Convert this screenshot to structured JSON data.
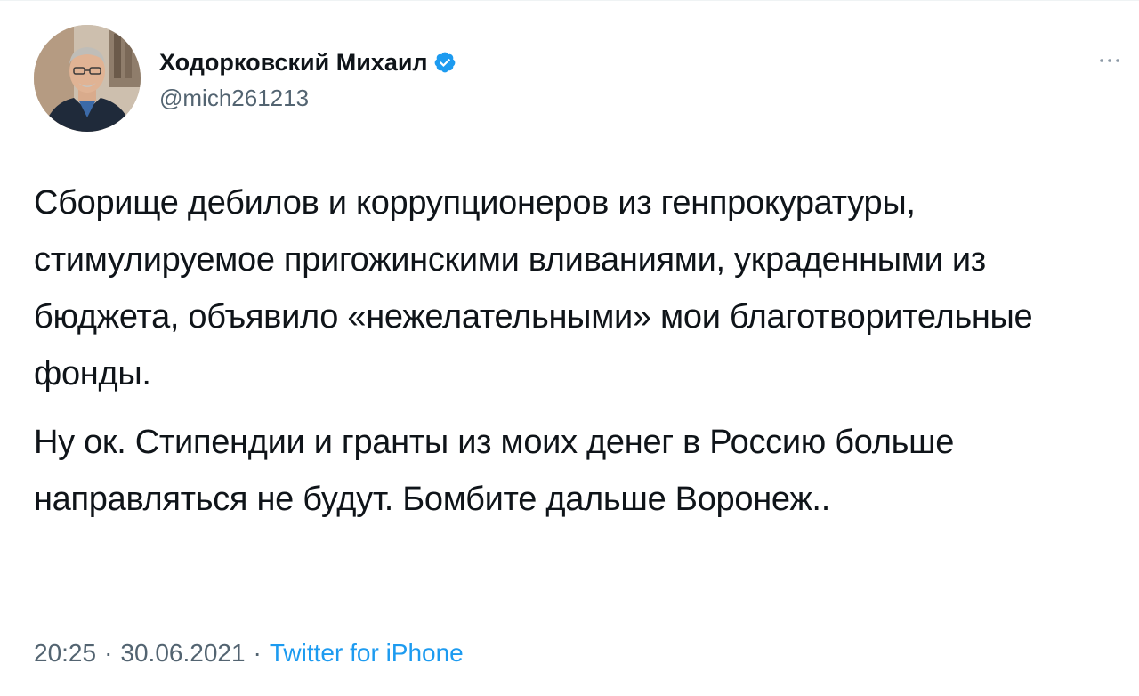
{
  "tweet": {
    "author": {
      "display_name": "Ходорковский Михаил",
      "handle": "@mich261213",
      "verified": true
    },
    "paragraphs": [
      "Сборище дебилов и коррупционеров из генпрокуратуры, стимулируемое пригожинскими вливаниями, украденными из бюджета, объявило «нежелательными» мои благотворительные фонды.",
      "Ну ок. Стипендии и гранты из моих денег в Россию больше направляться не будут. Бомбите дальше Воронеж.."
    ],
    "time": "20:25",
    "date": "30.06.2021",
    "separator": "·",
    "source": "Twitter for iPhone"
  },
  "icons": {
    "verified": "verified-badge-icon",
    "more": "more-dots-icon"
  },
  "colors": {
    "text": "#0f1419",
    "secondary": "#536471",
    "accent": "#1d9bf0"
  }
}
